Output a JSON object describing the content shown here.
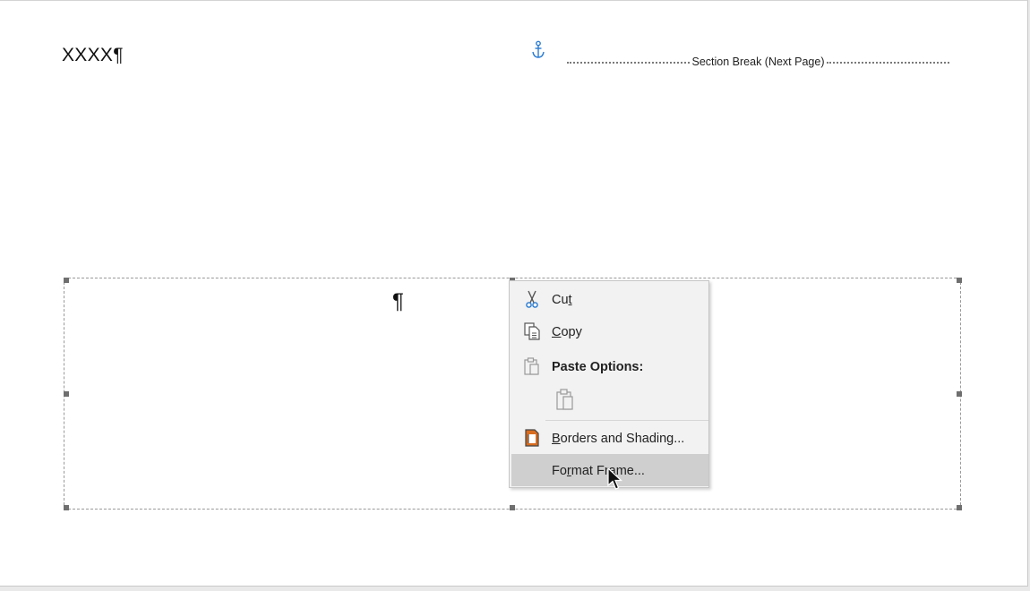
{
  "document": {
    "body_text": "XXXX¶",
    "section_break_label": "Section Break (Next Page)",
    "frame_pilcrow": "¶"
  },
  "context_menu": {
    "items": [
      {
        "id": "cut",
        "label": "Cut",
        "icon": "scissors-icon",
        "underline": "t"
      },
      {
        "id": "copy",
        "label": "Copy",
        "icon": "copy-icon",
        "underline": "C"
      },
      {
        "id": "paste-options",
        "label": "Paste Options:",
        "icon": "clipboard-icon"
      },
      {
        "id": "borders-shading",
        "label": "Borders and Shading...",
        "icon": "borders-shading-icon",
        "underline": "B"
      },
      {
        "id": "format-frame",
        "label": "Format Frame...",
        "icon": "",
        "underline": "r",
        "highlighted": true
      }
    ],
    "paste_option_icon": "paste-keep-text-icon"
  },
  "colors": {
    "anchor": "#2b7cd3",
    "menu_background": "#f2f2f2",
    "menu_highlight": "#cfcfcf",
    "borders_icon_accent": "#d86c1f"
  }
}
